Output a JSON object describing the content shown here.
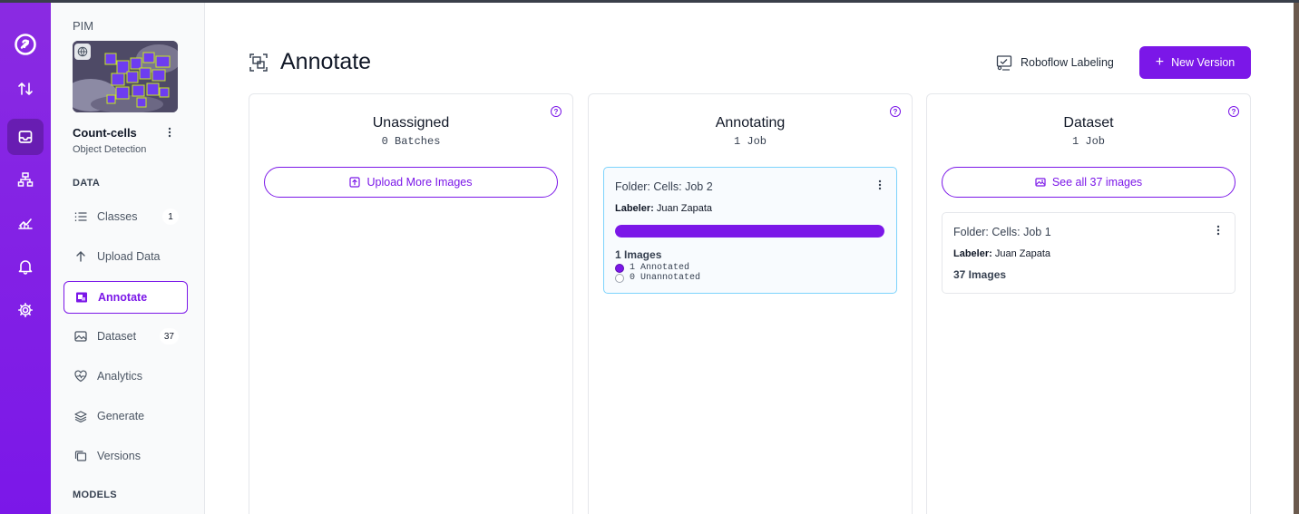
{
  "workspace": {
    "name": "PIM"
  },
  "project": {
    "name": "Count-cells",
    "type": "Object Detection"
  },
  "sidebar": {
    "data_section": "DATA",
    "models_section": "MODELS",
    "items": [
      {
        "label": "Classes",
        "badge": "1"
      },
      {
        "label": "Upload Data"
      },
      {
        "label": "Annotate"
      },
      {
        "label": "Dataset",
        "badge": "37"
      },
      {
        "label": "Analytics"
      },
      {
        "label": "Generate"
      },
      {
        "label": "Versions"
      }
    ]
  },
  "header": {
    "title": "Annotate",
    "roboflow_labeling": "Roboflow Labeling",
    "new_version": "New Version"
  },
  "columns": {
    "unassigned": {
      "title": "Unassigned",
      "subtitle": "0 Batches",
      "button": "Upload More Images"
    },
    "annotating": {
      "title": "Annotating",
      "subtitle": "1 Job",
      "job": {
        "folder": "Folder: Cells: Job 2",
        "labeler_prefix": "Labeler:",
        "labeler": "Juan Zapata",
        "progress": 1.0,
        "images": "1 Images",
        "annotated": "1 Annotated",
        "unannotated": "0 Unannotated"
      }
    },
    "dataset": {
      "title": "Dataset",
      "subtitle": "1 Job",
      "button": "See all 37 images",
      "job": {
        "folder": "Folder: Cells: Job 1",
        "labeler_prefix": "Labeler:",
        "labeler": "Juan Zapata",
        "images": "37 Images"
      }
    }
  },
  "colors": {
    "accent": "#7b17e8",
    "rail": "#8a2be2",
    "active_card_border": "#7dd3fc"
  }
}
